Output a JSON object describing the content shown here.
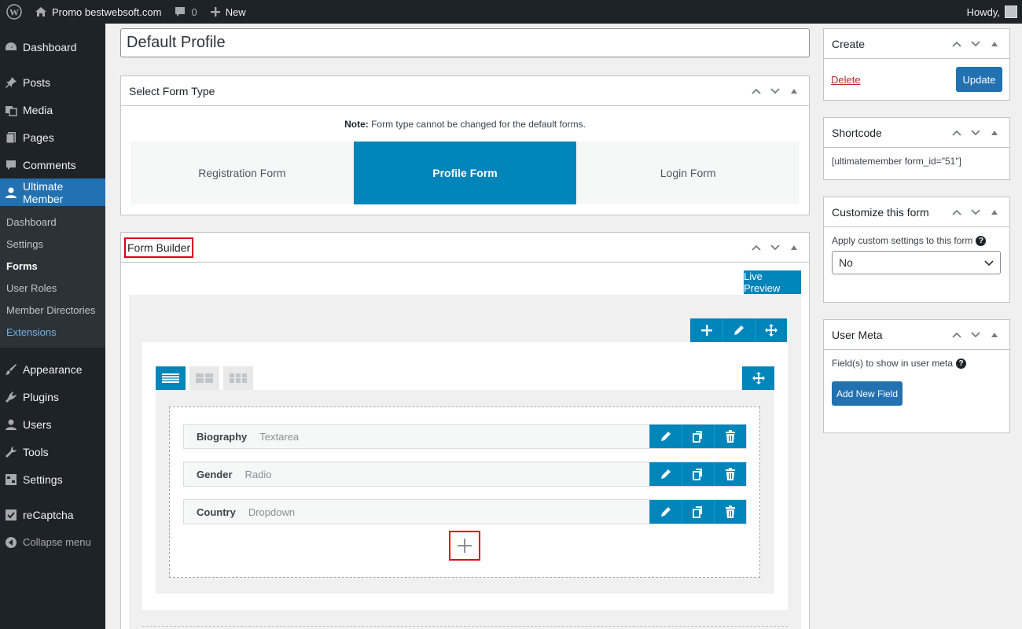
{
  "adminbar": {
    "site_name": "Promo bestwebsoft.com",
    "comments_count": "0",
    "new_label": "New",
    "howdy": "Howdy,"
  },
  "sidebar": {
    "top_items": [
      {
        "label": "Dashboard",
        "icon": "dashboard-icon"
      },
      {
        "label": "Posts",
        "icon": "pin-icon"
      },
      {
        "label": "Media",
        "icon": "media-icon"
      },
      {
        "label": "Pages",
        "icon": "pages-icon"
      },
      {
        "label": "Comments",
        "icon": "comments-icon"
      },
      {
        "label": "Ultimate Member",
        "icon": "user-icon"
      }
    ],
    "submenu": [
      "Dashboard",
      "Settings",
      "Forms",
      "User Roles",
      "Member Directories",
      "Extensions"
    ],
    "bottom_items": [
      {
        "label": "Appearance",
        "icon": "brush-icon"
      },
      {
        "label": "Plugins",
        "icon": "plugin-icon"
      },
      {
        "label": "Users",
        "icon": "users-icon"
      },
      {
        "label": "Tools",
        "icon": "wrench-icon"
      },
      {
        "label": "Settings",
        "icon": "settings-icon"
      },
      {
        "label": "reCaptcha",
        "icon": "checkbox-icon"
      }
    ],
    "collapse_label": "Collapse menu"
  },
  "main": {
    "form_title": "Default Profile",
    "select_form_type": {
      "title": "Select Form Type",
      "note_bold": "Note:",
      "note_text": " Form type cannot be changed for the default forms.",
      "types": [
        "Registration Form",
        "Profile Form",
        "Login Form"
      ],
      "active": "Profile Form"
    },
    "form_builder": {
      "title": "Form Builder",
      "live_preview": "Live Preview",
      "fields": [
        {
          "name": "Biography",
          "type": "Textarea"
        },
        {
          "name": "Gender",
          "type": "Radio"
        },
        {
          "name": "Country",
          "type": "Dropdown"
        }
      ]
    }
  },
  "side": {
    "create": {
      "title": "Create",
      "delete": "Delete",
      "update": "Update"
    },
    "shortcode": {
      "title": "Shortcode",
      "value": "[ultimatemember form_id=\"51\"]"
    },
    "customize": {
      "title": "Customize this form",
      "label": "Apply custom settings to this form",
      "selected": "No"
    },
    "user_meta": {
      "title": "User Meta",
      "label": "Field(s) to show in user meta",
      "add_button": "Add New Field"
    }
  },
  "colors": {
    "accent": "#0085ba",
    "wp_blue": "#2271b1",
    "sidebar_bg": "#1d2327",
    "highlight": "#e0001a",
    "delete_red": "#b32d2e"
  }
}
